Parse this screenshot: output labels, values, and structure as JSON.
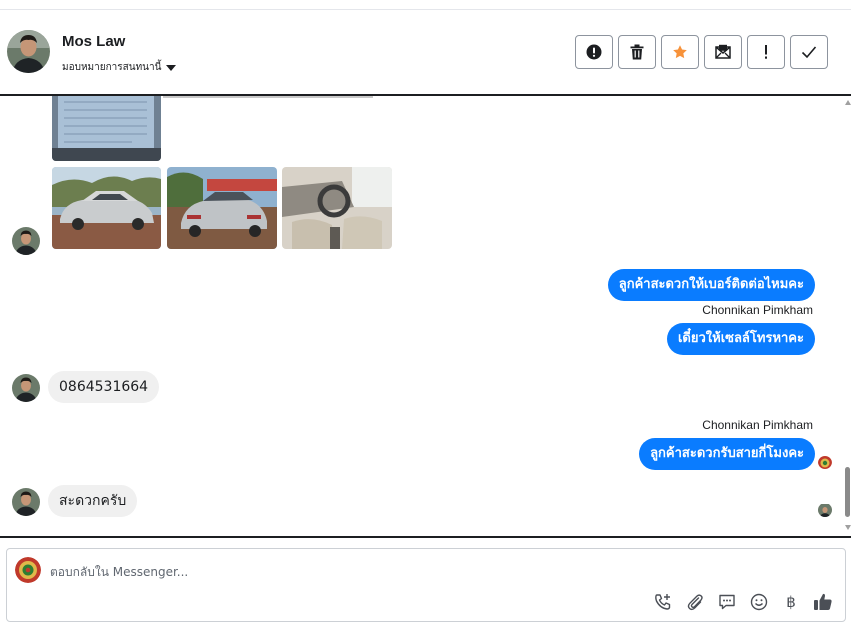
{
  "header": {
    "contact_name": "Mos Law",
    "assign_label": "มอบหมายการสนทนานี้"
  },
  "toolbar": {
    "icons": [
      "alert-circle-icon",
      "trash-icon",
      "star-icon",
      "mail-blocked-icon",
      "exclamation-icon",
      "check-icon"
    ],
    "star_color": "#f7923a"
  },
  "conversation": {
    "messages": [
      {
        "direction": "out",
        "text": "ลูกค้าสะดวกให้เบอร์ติดต่อไหมคะ"
      },
      {
        "direction": "out",
        "sender": "Chonnikan Pimkham",
        "text": "เดี๋ยวให้เซลล์โทรหาคะ"
      },
      {
        "direction": "in",
        "text": "0864531664"
      },
      {
        "direction": "out",
        "sender": "Chonnikan Pimkham",
        "text": "ลูกค้าสะดวกรับสายกี่โมงคะ"
      },
      {
        "direction": "in",
        "text": "สะดวกครับ"
      }
    ],
    "bubble_color": "#0a7cff"
  },
  "composer": {
    "placeholder": "ตอบกลับใน Messenger...",
    "tools": [
      "phone-plus-icon",
      "paperclip-icon",
      "chat-bubble-icon",
      "smiley-icon",
      "baht-icon",
      "thumbs-up-icon"
    ],
    "baht_symbol": "฿"
  }
}
